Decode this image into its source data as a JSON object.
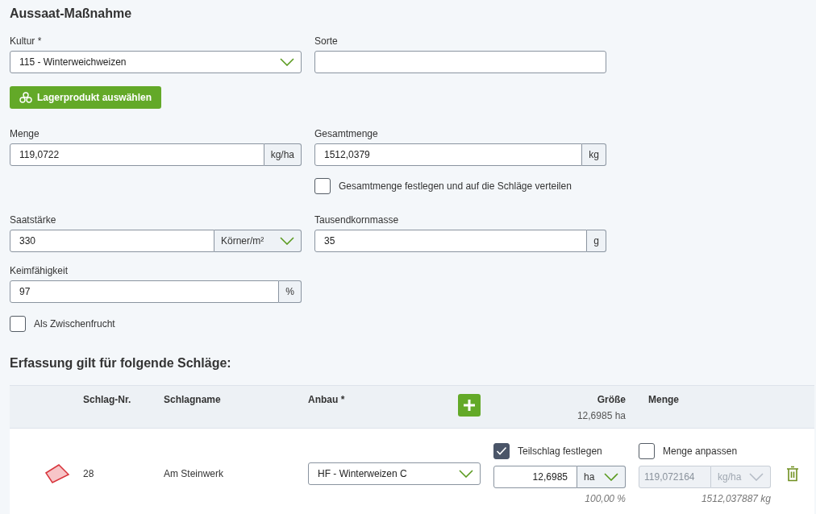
{
  "title": "Aussaat-Maßnahme",
  "kultur": {
    "label": "Kultur *",
    "value": "115 - Winterweichweizen"
  },
  "sorte": {
    "label": "Sorte"
  },
  "stock_button": {
    "label": "Lagerprodukt auswählen"
  },
  "menge": {
    "label": "Menge",
    "value": "119,0722",
    "unit": "kg/ha",
    "unit_dropdown": false
  },
  "gesamtmenge": {
    "label": "Gesamtmenge",
    "value": "1512,0379",
    "unit": "kg",
    "unit_dropdown": false
  },
  "distribute_checkbox": {
    "label": "Gesamtmenge festlegen und auf die Schläge verteilen",
    "checked": false
  },
  "saatstaerke": {
    "label": "Saatstärke",
    "value": "330",
    "unit": "Körner/m²",
    "unit_dropdown": true
  },
  "tausendkornmasse": {
    "label": "Tausendkornmasse",
    "value": "35",
    "unit": "g",
    "unit_dropdown": false
  },
  "keimfaehigkeit": {
    "label": "Keimfähigkeit",
    "value": "97",
    "unit": "%",
    "unit_dropdown": false
  },
  "catch_crop_checkbox": {
    "label": "Als Zwischenfrucht",
    "checked": false
  },
  "fields_section": {
    "heading": "Erfassung gilt für folgende Schläge:",
    "columns": [
      "Schlag-Nr.",
      "Schlagname",
      "Anbau *",
      "Größe",
      "Menge"
    ],
    "total_size": "12,6985 ha",
    "rows": [
      {
        "number": "28",
        "name": "Am Steinwerk",
        "crop": "HF - Winterweizen C",
        "partial": {
          "label": "Teilschlag festlegen",
          "checked": true
        },
        "area": "12,6985",
        "area_unit": "ha",
        "area_share": "100,00 %",
        "adjust": {
          "label": "Menge anpassen",
          "checked": false
        },
        "rate": "119,072164",
        "rate_unit": "kg/ha",
        "rate_disabled": true,
        "total": "1512,037887 kg"
      }
    ]
  }
}
